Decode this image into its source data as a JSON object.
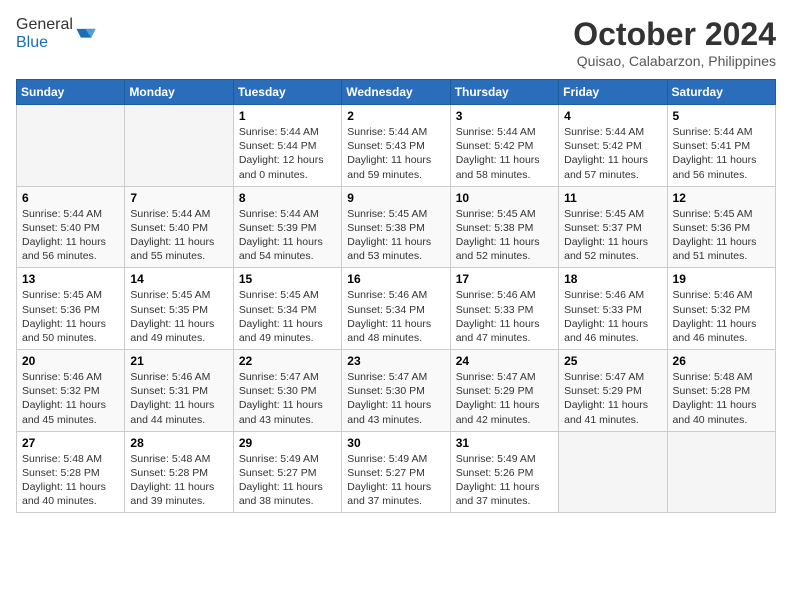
{
  "header": {
    "logo_general": "General",
    "logo_blue": "Blue",
    "month_title": "October 2024",
    "location": "Quisao, Calabarzon, Philippines"
  },
  "weekdays": [
    "Sunday",
    "Monday",
    "Tuesday",
    "Wednesday",
    "Thursday",
    "Friday",
    "Saturday"
  ],
  "weeks": [
    [
      {
        "day": "",
        "sunrise": "",
        "sunset": "",
        "daylight": ""
      },
      {
        "day": "",
        "sunrise": "",
        "sunset": "",
        "daylight": ""
      },
      {
        "day": "1",
        "sunrise": "Sunrise: 5:44 AM",
        "sunset": "Sunset: 5:44 PM",
        "daylight": "Daylight: 12 hours and 0 minutes."
      },
      {
        "day": "2",
        "sunrise": "Sunrise: 5:44 AM",
        "sunset": "Sunset: 5:43 PM",
        "daylight": "Daylight: 11 hours and 59 minutes."
      },
      {
        "day": "3",
        "sunrise": "Sunrise: 5:44 AM",
        "sunset": "Sunset: 5:42 PM",
        "daylight": "Daylight: 11 hours and 58 minutes."
      },
      {
        "day": "4",
        "sunrise": "Sunrise: 5:44 AM",
        "sunset": "Sunset: 5:42 PM",
        "daylight": "Daylight: 11 hours and 57 minutes."
      },
      {
        "day": "5",
        "sunrise": "Sunrise: 5:44 AM",
        "sunset": "Sunset: 5:41 PM",
        "daylight": "Daylight: 11 hours and 56 minutes."
      }
    ],
    [
      {
        "day": "6",
        "sunrise": "Sunrise: 5:44 AM",
        "sunset": "Sunset: 5:40 PM",
        "daylight": "Daylight: 11 hours and 56 minutes."
      },
      {
        "day": "7",
        "sunrise": "Sunrise: 5:44 AM",
        "sunset": "Sunset: 5:40 PM",
        "daylight": "Daylight: 11 hours and 55 minutes."
      },
      {
        "day": "8",
        "sunrise": "Sunrise: 5:44 AM",
        "sunset": "Sunset: 5:39 PM",
        "daylight": "Daylight: 11 hours and 54 minutes."
      },
      {
        "day": "9",
        "sunrise": "Sunrise: 5:45 AM",
        "sunset": "Sunset: 5:38 PM",
        "daylight": "Daylight: 11 hours and 53 minutes."
      },
      {
        "day": "10",
        "sunrise": "Sunrise: 5:45 AM",
        "sunset": "Sunset: 5:38 PM",
        "daylight": "Daylight: 11 hours and 52 minutes."
      },
      {
        "day": "11",
        "sunrise": "Sunrise: 5:45 AM",
        "sunset": "Sunset: 5:37 PM",
        "daylight": "Daylight: 11 hours and 52 minutes."
      },
      {
        "day": "12",
        "sunrise": "Sunrise: 5:45 AM",
        "sunset": "Sunset: 5:36 PM",
        "daylight": "Daylight: 11 hours and 51 minutes."
      }
    ],
    [
      {
        "day": "13",
        "sunrise": "Sunrise: 5:45 AM",
        "sunset": "Sunset: 5:36 PM",
        "daylight": "Daylight: 11 hours and 50 minutes."
      },
      {
        "day": "14",
        "sunrise": "Sunrise: 5:45 AM",
        "sunset": "Sunset: 5:35 PM",
        "daylight": "Daylight: 11 hours and 49 minutes."
      },
      {
        "day": "15",
        "sunrise": "Sunrise: 5:45 AM",
        "sunset": "Sunset: 5:34 PM",
        "daylight": "Daylight: 11 hours and 49 minutes."
      },
      {
        "day": "16",
        "sunrise": "Sunrise: 5:46 AM",
        "sunset": "Sunset: 5:34 PM",
        "daylight": "Daylight: 11 hours and 48 minutes."
      },
      {
        "day": "17",
        "sunrise": "Sunrise: 5:46 AM",
        "sunset": "Sunset: 5:33 PM",
        "daylight": "Daylight: 11 hours and 47 minutes."
      },
      {
        "day": "18",
        "sunrise": "Sunrise: 5:46 AM",
        "sunset": "Sunset: 5:33 PM",
        "daylight": "Daylight: 11 hours and 46 minutes."
      },
      {
        "day": "19",
        "sunrise": "Sunrise: 5:46 AM",
        "sunset": "Sunset: 5:32 PM",
        "daylight": "Daylight: 11 hours and 46 minutes."
      }
    ],
    [
      {
        "day": "20",
        "sunrise": "Sunrise: 5:46 AM",
        "sunset": "Sunset: 5:32 PM",
        "daylight": "Daylight: 11 hours and 45 minutes."
      },
      {
        "day": "21",
        "sunrise": "Sunrise: 5:46 AM",
        "sunset": "Sunset: 5:31 PM",
        "daylight": "Daylight: 11 hours and 44 minutes."
      },
      {
        "day": "22",
        "sunrise": "Sunrise: 5:47 AM",
        "sunset": "Sunset: 5:30 PM",
        "daylight": "Daylight: 11 hours and 43 minutes."
      },
      {
        "day": "23",
        "sunrise": "Sunrise: 5:47 AM",
        "sunset": "Sunset: 5:30 PM",
        "daylight": "Daylight: 11 hours and 43 minutes."
      },
      {
        "day": "24",
        "sunrise": "Sunrise: 5:47 AM",
        "sunset": "Sunset: 5:29 PM",
        "daylight": "Daylight: 11 hours and 42 minutes."
      },
      {
        "day": "25",
        "sunrise": "Sunrise: 5:47 AM",
        "sunset": "Sunset: 5:29 PM",
        "daylight": "Daylight: 11 hours and 41 minutes."
      },
      {
        "day": "26",
        "sunrise": "Sunrise: 5:48 AM",
        "sunset": "Sunset: 5:28 PM",
        "daylight": "Daylight: 11 hours and 40 minutes."
      }
    ],
    [
      {
        "day": "27",
        "sunrise": "Sunrise: 5:48 AM",
        "sunset": "Sunset: 5:28 PM",
        "daylight": "Daylight: 11 hours and 40 minutes."
      },
      {
        "day": "28",
        "sunrise": "Sunrise: 5:48 AM",
        "sunset": "Sunset: 5:28 PM",
        "daylight": "Daylight: 11 hours and 39 minutes."
      },
      {
        "day": "29",
        "sunrise": "Sunrise: 5:49 AM",
        "sunset": "Sunset: 5:27 PM",
        "daylight": "Daylight: 11 hours and 38 minutes."
      },
      {
        "day": "30",
        "sunrise": "Sunrise: 5:49 AM",
        "sunset": "Sunset: 5:27 PM",
        "daylight": "Daylight: 11 hours and 37 minutes."
      },
      {
        "day": "31",
        "sunrise": "Sunrise: 5:49 AM",
        "sunset": "Sunset: 5:26 PM",
        "daylight": "Daylight: 11 hours and 37 minutes."
      },
      {
        "day": "",
        "sunrise": "",
        "sunset": "",
        "daylight": ""
      },
      {
        "day": "",
        "sunrise": "",
        "sunset": "",
        "daylight": ""
      }
    ]
  ]
}
